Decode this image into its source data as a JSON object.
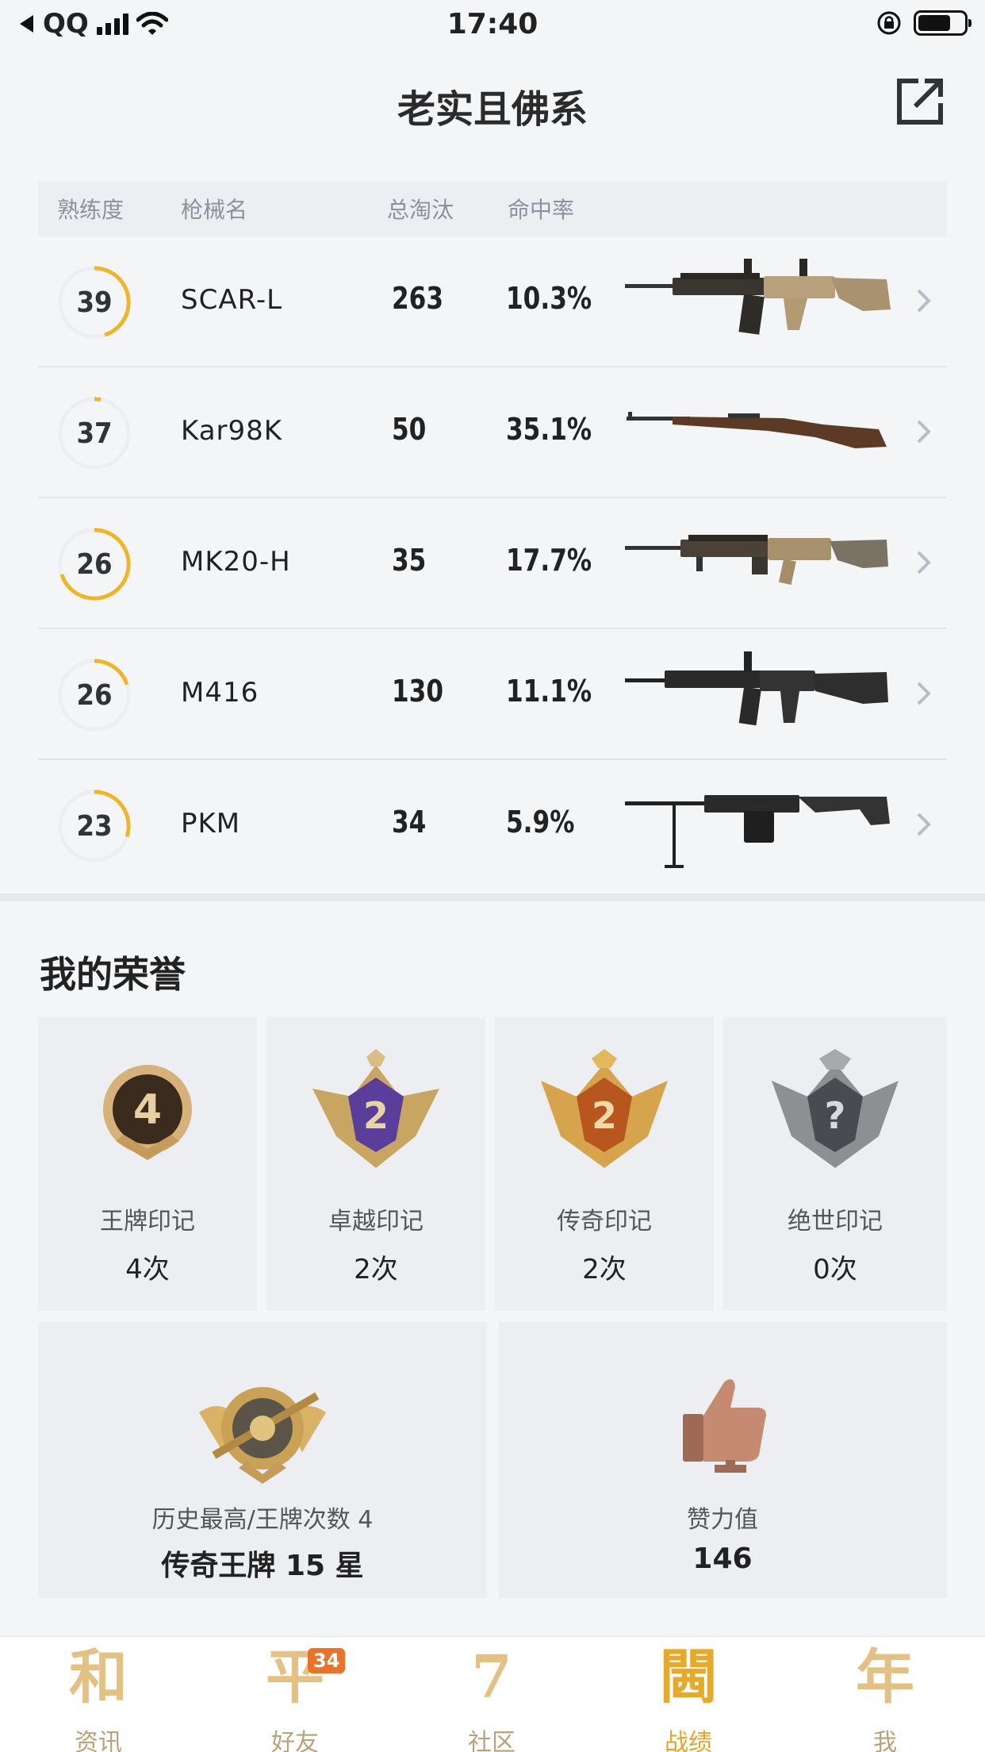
{
  "status_bar": {
    "carrier": "QQ",
    "time": "17:40"
  },
  "header": {
    "title": "老实且佛系"
  },
  "weapons": {
    "columns": {
      "mastery": "熟练度",
      "name": "枪械名",
      "kills": "总淘汰",
      "accuracy": "命中率"
    },
    "rows": [
      {
        "level": "39",
        "progress": 0.45,
        "name": "SCAR-L",
        "kills": "263",
        "accuracy": "10.3%"
      },
      {
        "level": "37",
        "progress": 0.03,
        "name": "Kar98K",
        "kills": "50",
        "accuracy": "35.1%"
      },
      {
        "level": "26",
        "progress": 0.7,
        "name": "MK20-H",
        "kills": "35",
        "accuracy": "17.7%"
      },
      {
        "level": "26",
        "progress": 0.2,
        "name": "M416",
        "kills": "130",
        "accuracy": "11.1%"
      },
      {
        "level": "23",
        "progress": 0.3,
        "name": "PKM",
        "kills": "34",
        "accuracy": "5.9%"
      }
    ]
  },
  "honor": {
    "title": "我的荣誉",
    "marks": [
      {
        "label": "王牌印记",
        "value": "4次",
        "emblem_text": "4"
      },
      {
        "label": "卓越印记",
        "value": "2次",
        "emblem_text": "2"
      },
      {
        "label": "传奇印记",
        "value": "2次",
        "emblem_text": "2"
      },
      {
        "label": "绝世印记",
        "value": "0次",
        "emblem_text": "?"
      }
    ],
    "history": {
      "label": "历史最高/王牌次数 4",
      "value": "传奇王牌 15 星"
    },
    "likes": {
      "label": "赞力值",
      "value": "146"
    }
  },
  "tabbar": {
    "tabs": [
      {
        "icon_char": "和",
        "label": "资讯"
      },
      {
        "icon_char": "平",
        "label": "好友",
        "badge": "34"
      },
      {
        "icon_char": "7",
        "label": "社区"
      },
      {
        "icon_char": "閪",
        "label": "战绩"
      },
      {
        "icon_char": "年",
        "label": "我"
      }
    ],
    "active_index": 3
  },
  "colors": {
    "accent": "#f0b429",
    "ring_track": "#eceef2",
    "tab_inactive": "#e3c083"
  }
}
